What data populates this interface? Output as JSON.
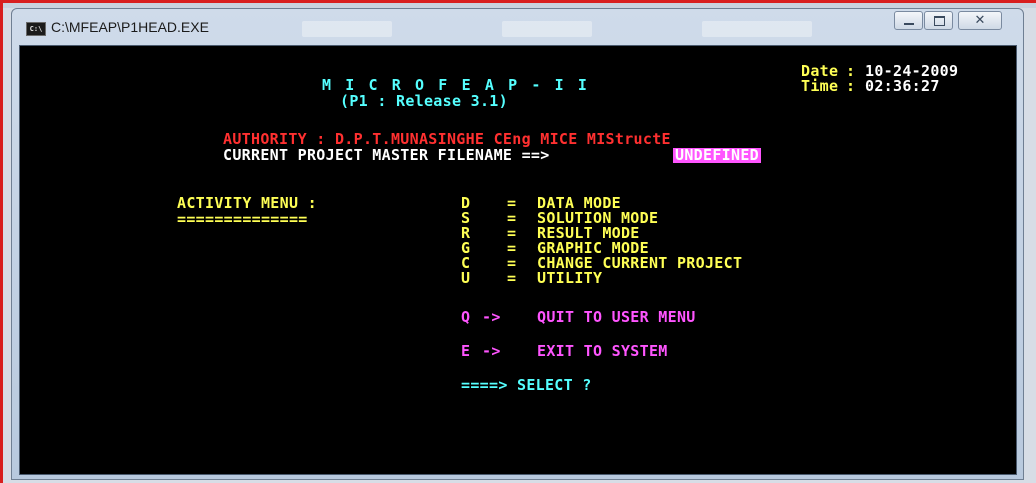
{
  "window": {
    "title": "C:\\MFEAP\\P1HEAD.EXE",
    "icon": "console-icon",
    "icon_text": "C:\\",
    "close_glyph": "✕"
  },
  "console": {
    "program_title": "M I C R O F E A P - I I",
    "release": "(P1 : Release 3.1)",
    "date_label": "Date",
    "date": "10-24-2009",
    "time_label": "Time",
    "time": "02:36:27",
    "authority": "AUTHORITY : D.P.T.MUNASINGHE CEng MICE MIStructE",
    "project_label": "CURRENT PROJECT MASTER FILENAME ==>",
    "project_value": "UNDEFINED",
    "menu_heading": "ACTIVITY MENU :",
    "menu_underline": "==============",
    "menu_items": [
      {
        "key": "D",
        "sep": "=",
        "label": "DATA MODE"
      },
      {
        "key": "S",
        "sep": "=",
        "label": "SOLUTION MODE"
      },
      {
        "key": "R",
        "sep": "=",
        "label": "RESULT MODE"
      },
      {
        "key": "G",
        "sep": "=",
        "label": "GRAPHIC MODE"
      },
      {
        "key": "C",
        "sep": "=",
        "label": "CHANGE CURRENT PROJECT"
      },
      {
        "key": "U",
        "sep": "=",
        "label": "UTILITY"
      }
    ],
    "quit": {
      "key": "Q",
      "arrow": "->",
      "label": "QUIT TO USER MENU"
    },
    "exit": {
      "key": "E",
      "arrow": "->",
      "label": "EXIT TO SYSTEM"
    },
    "prompt": "====> SELECT ?"
  },
  "colors": {
    "console_bg": "#000000",
    "yellow": "#ffff55",
    "red": "#ff3030",
    "cyan": "#55ffff",
    "magenta": "#ff55ff",
    "white": "#ffffff"
  }
}
